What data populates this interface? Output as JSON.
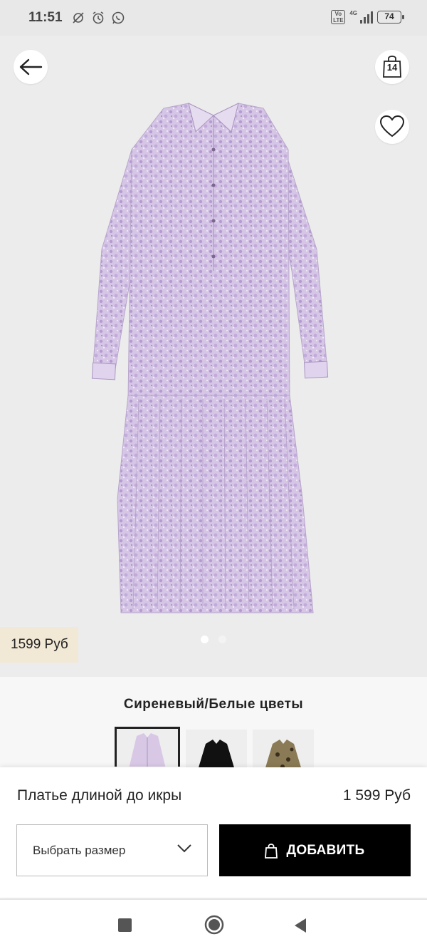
{
  "status_bar": {
    "time": "11:51",
    "network": "4G",
    "volte": "Vo LTE",
    "battery": "74"
  },
  "header": {
    "cart_count": "14"
  },
  "product": {
    "price_badge": "1599 Руб",
    "color_name": "Сиреневый/Белые цветы",
    "name": "Платье длиной до икры",
    "price": "1 599 Руб",
    "image_count": 2,
    "active_image_index": 0
  },
  "swatches": [
    {
      "label": "lilac-floral",
      "color": "#d8c8e6",
      "selected": true
    },
    {
      "label": "black",
      "color": "#111111",
      "selected": false
    },
    {
      "label": "leopard",
      "color": "#8a7a55",
      "selected": false
    }
  ],
  "actions": {
    "size_placeholder": "Выбрать размер",
    "add_label": "ДОБАВИТЬ"
  },
  "colors": {
    "price_badge_bg": "#f2e8d6",
    "add_button_bg": "#000000",
    "dress_base": "#d9c9e8"
  }
}
